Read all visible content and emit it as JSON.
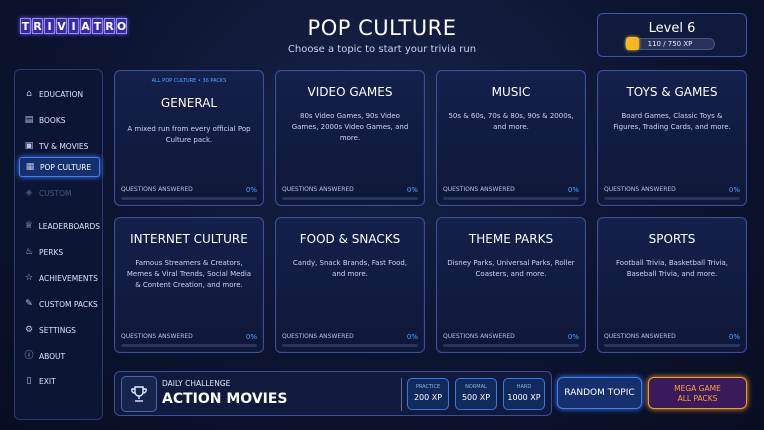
{
  "app": {
    "logo_letters": [
      "T",
      "R",
      "I",
      "V",
      "I",
      "A",
      "T",
      "R",
      "O"
    ]
  },
  "header": {
    "title": "POP CULTURE",
    "subtitle": "Choose a topic to start your trivia run"
  },
  "level": {
    "label": "Level 6",
    "xp_text": "110 / 750 XP",
    "xp_fraction": 0.1467,
    "accent_color": "#f6a90e"
  },
  "sidebar": {
    "items": [
      {
        "label": "EDUCATION",
        "icon": "graduation-cap-icon",
        "state": "normal"
      },
      {
        "label": "BOOKS",
        "icon": "book-icon",
        "state": "normal"
      },
      {
        "label": "TV & MOVIES",
        "icon": "film-icon",
        "state": "normal"
      },
      {
        "label": "POP CULTURE",
        "icon": "pop-culture-icon",
        "state": "active"
      },
      {
        "label": "CUSTOM",
        "icon": "layers-icon",
        "state": "disabled"
      },
      {
        "label": "LEADERBOARDS",
        "icon": "trophy-icon",
        "state": "normal"
      },
      {
        "label": "PERKS",
        "icon": "flame-icon",
        "state": "normal"
      },
      {
        "label": "ACHIEVEMENTS",
        "icon": "medal-icon",
        "state": "normal"
      },
      {
        "label": "CUSTOM PACKS",
        "icon": "edit-icon",
        "state": "normal"
      },
      {
        "label": "SETTINGS",
        "icon": "gear-icon",
        "state": "normal"
      },
      {
        "label": "ABOUT",
        "icon": "info-icon",
        "state": "normal"
      },
      {
        "label": "EXIT",
        "icon": "exit-door-icon",
        "state": "normal"
      }
    ]
  },
  "topics": [
    {
      "eyebrow": "ALL POP CULTURE • 36 PACKS",
      "title": "GENERAL",
      "description": "A mixed run from every official Pop Culture pack.",
      "qa_label": "QUESTIONS ANSWERED",
      "percent": "0%"
    },
    {
      "title": "VIDEO GAMES",
      "description": "80s Video Games, 90s Video Games, 2000s Video Games, and more.",
      "qa_label": "QUESTIONS ANSWERED",
      "percent": "0%"
    },
    {
      "title": "MUSIC",
      "description": "50s & 60s, 70s & 80s, 90s & 2000s, and more.",
      "qa_label": "QUESTIONS ANSWERED",
      "percent": "0%"
    },
    {
      "title": "TOYS & GAMES",
      "description": "Board Games, Classic Toys & Figures, Trading Cards, and more.",
      "qa_label": "QUESTIONS ANSWERED",
      "percent": "0%"
    },
    {
      "title": "INTERNET CULTURE",
      "description": "Famous Streamers & Creators, Memes & Viral Trends, Social Media & Content Creation, and more.",
      "qa_label": "QUESTIONS ANSWERED",
      "percent": "0%"
    },
    {
      "title": "FOOD & SNACKS",
      "description": "Candy, Snack Brands, Fast Food, and more.",
      "qa_label": "QUESTIONS ANSWERED",
      "percent": "0%"
    },
    {
      "title": "THEME PARKS",
      "description": "Disney Parks, Universal Parks, Roller Coasters, and more.",
      "qa_label": "QUESTIONS ANSWERED",
      "percent": "0%"
    },
    {
      "title": "SPORTS",
      "description": "Football Trivia, Basketball Trivia, Baseball Trivia, and more.",
      "qa_label": "QUESTIONS ANSWERED",
      "percent": "0%"
    }
  ],
  "daily": {
    "label": "DAILY CHALLENGE",
    "value": "ACTION MOVIES",
    "difficulties": [
      {
        "label": "PRACTICE",
        "xp": "200 XP"
      },
      {
        "label": "NORMAL",
        "xp": "500 XP"
      },
      {
        "label": "HARD",
        "xp": "1000 XP"
      }
    ]
  },
  "actions": {
    "random_label": "RANDOM TOPIC",
    "mega_line1": "MEGA GAME",
    "mega_line2": "ALL PACKS"
  }
}
